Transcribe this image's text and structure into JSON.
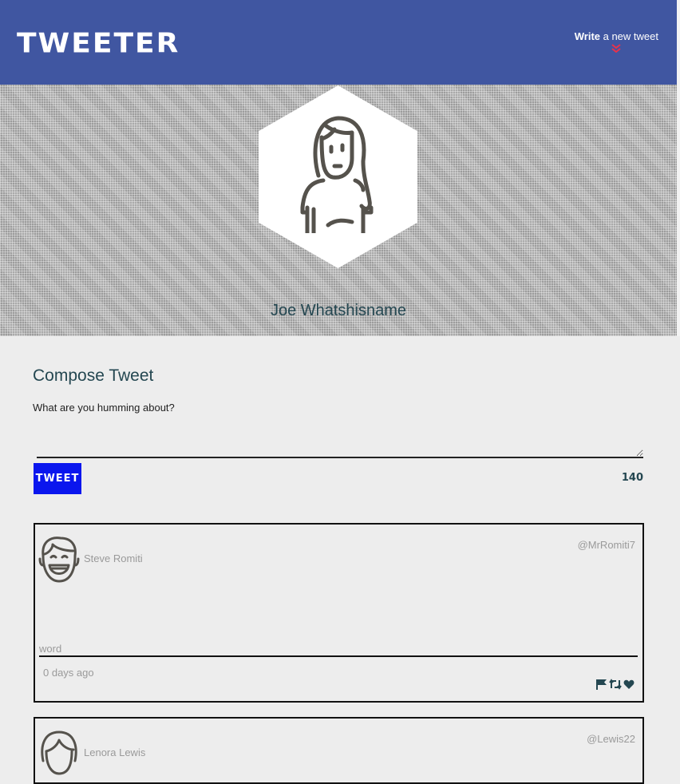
{
  "nav": {
    "logo": "TWEETER",
    "write_bold": "Write",
    "write_rest": " a new tweet",
    "chevron_color": "#e8324a"
  },
  "profile": {
    "name": "Joe Whatshisname",
    "avatar_icon": "woman-avatar-icon"
  },
  "compose": {
    "title": "Compose Tweet",
    "label": "What are you humming about?",
    "input_value": "",
    "button_label": "TWEET",
    "counter": "140"
  },
  "tweets": [
    {
      "name": "Steve Romiti",
      "handle": "@MrRomiti7",
      "content": "word",
      "time": "0 days ago",
      "avatar_icon": "man-smiling-avatar-icon"
    },
    {
      "name": "Lenora Lewis",
      "handle": "@Lewis22",
      "avatar_icon": "woman-avatar-icon"
    }
  ],
  "colors": {
    "nav": "#4056a1",
    "accent": "#244751",
    "button": "#0a16ee",
    "background": "#ededed"
  }
}
